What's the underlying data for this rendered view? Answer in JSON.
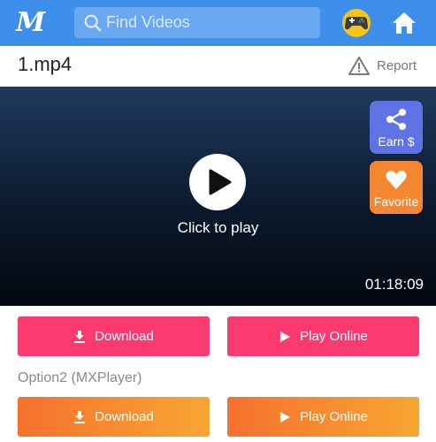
{
  "header": {
    "logo_text": "M",
    "search_placeholder": "Find Videos",
    "icons": [
      "search-icon",
      "game-controller-icon",
      "home-icon"
    ],
    "colors": {
      "bar": "#3e8eec",
      "search_bg": "#6aa8f1"
    }
  },
  "video": {
    "title": "1.mp4",
    "report_label": "Report",
    "click_to_play": "Click to play",
    "duration": "01:18:09"
  },
  "side_actions": {
    "earn_label": "Earn $",
    "favorite_label": "Favorite",
    "colors": {
      "earn": "#5f73e6",
      "favorite": "#f58732"
    }
  },
  "option1": {
    "download_label": "Download",
    "play_online_label": "Play Online",
    "color": "#fb3a6f"
  },
  "option2": {
    "heading": "Option2 (MXPlayer)",
    "download_label": "Download",
    "play_online_label": "Play Online",
    "colors": [
      "#f6712e",
      "#f8a632"
    ]
  }
}
